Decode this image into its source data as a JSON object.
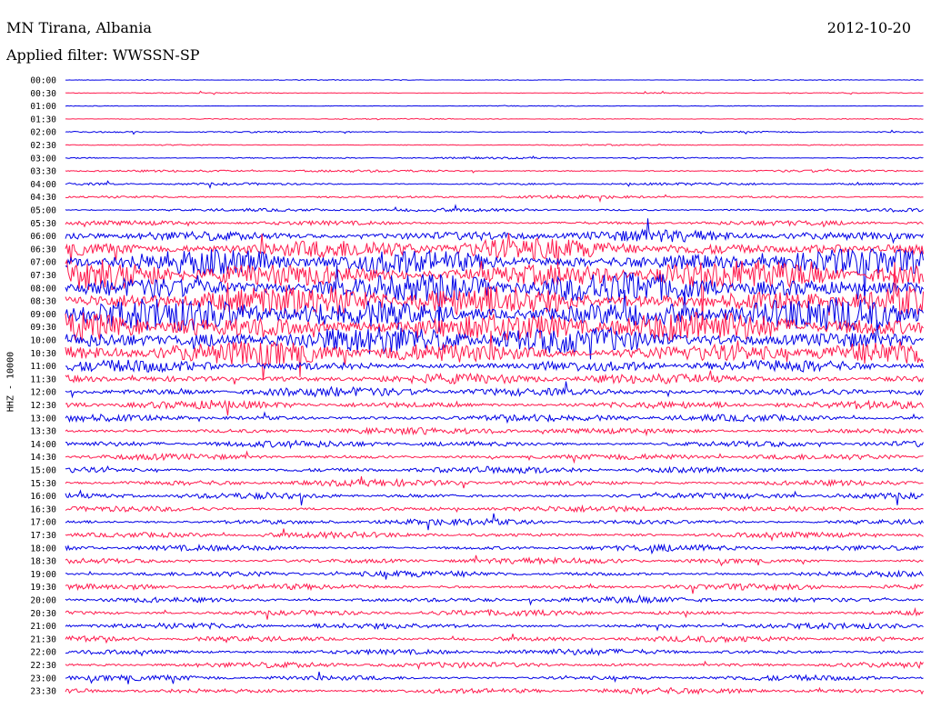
{
  "header": {
    "station": "MN Tirana, Albania",
    "filter": "Applied filter: WWSSN-SP",
    "date": "2012-10-20"
  },
  "chart_data": {
    "type": "line",
    "title": "MN Tirana, Albania",
    "subtitle": "Applied filter: WWSSN-SP",
    "date": "2012-10-20",
    "ylabel": "HHZ - 10000",
    "xlabel": "",
    "tick_labels": [
      "00:00",
      "00:30",
      "01:00",
      "01:30",
      "02:00",
      "02:30",
      "03:00",
      "03:30",
      "04:00",
      "04:30",
      "05:00",
      "05:30",
      "06:00",
      "06:30",
      "07:00",
      "07:30",
      "08:00",
      "08:30",
      "09:00",
      "09:30",
      "10:00",
      "10:30",
      "11:00",
      "11:30",
      "12:00",
      "12:30",
      "13:00",
      "13:30",
      "14:00",
      "14:30",
      "15:00",
      "15:30",
      "16:00",
      "16:30",
      "17:00",
      "17:30",
      "18:00",
      "18:30",
      "19:00",
      "19:30",
      "20:00",
      "20:30",
      "21:00",
      "21:30",
      "22:00",
      "22:30",
      "23:00",
      "23:30"
    ],
    "trace_colors": [
      "#0000e6",
      "#ff1a4d"
    ],
    "grid": false,
    "rows": [
      {
        "start": "00:00",
        "activity": 0.06
      },
      {
        "start": "00:30",
        "activity": 0.08
      },
      {
        "start": "01:00",
        "activity": 0.06
      },
      {
        "start": "01:30",
        "activity": 0.08
      },
      {
        "start": "02:00",
        "activity": 0.12
      },
      {
        "start": "02:30",
        "activity": 0.1
      },
      {
        "start": "03:00",
        "activity": 0.14
      },
      {
        "start": "03:30",
        "activity": 0.18
      },
      {
        "start": "04:00",
        "activity": 0.2
      },
      {
        "start": "04:30",
        "activity": 0.22
      },
      {
        "start": "05:00",
        "activity": 0.25
      },
      {
        "start": "05:30",
        "activity": 0.35
      },
      {
        "start": "06:00",
        "activity": 0.9
      },
      {
        "start": "06:30",
        "activity": 1.6
      },
      {
        "start": "07:00",
        "activity": 2.0
      },
      {
        "start": "07:30",
        "activity": 2.2
      },
      {
        "start": "08:00",
        "activity": 2.4
      },
      {
        "start": "08:30",
        "activity": 2.5
      },
      {
        "start": "09:00",
        "activity": 2.5
      },
      {
        "start": "09:30",
        "activity": 2.4
      },
      {
        "start": "10:00",
        "activity": 2.2
      },
      {
        "start": "10:30",
        "activity": 1.8
      },
      {
        "start": "11:00",
        "activity": 0.9
      },
      {
        "start": "11:30",
        "activity": 0.8
      },
      {
        "start": "12:00",
        "activity": 0.7
      },
      {
        "start": "12:30",
        "activity": 0.6
      },
      {
        "start": "13:00",
        "activity": 0.55
      },
      {
        "start": "13:30",
        "activity": 0.5
      },
      {
        "start": "14:00",
        "activity": 0.5
      },
      {
        "start": "14:30",
        "activity": 0.45
      },
      {
        "start": "15:00",
        "activity": 0.5
      },
      {
        "start": "15:30",
        "activity": 0.5
      },
      {
        "start": "16:00",
        "activity": 0.45
      },
      {
        "start": "16:30",
        "activity": 0.45
      },
      {
        "start": "17:00",
        "activity": 0.45
      },
      {
        "start": "17:30",
        "activity": 0.45
      },
      {
        "start": "18:00",
        "activity": 0.45
      },
      {
        "start": "18:30",
        "activity": 0.45
      },
      {
        "start": "19:00",
        "activity": 0.45
      },
      {
        "start": "19:30",
        "activity": 0.45
      },
      {
        "start": "20:00",
        "activity": 0.45
      },
      {
        "start": "20:30",
        "activity": 0.45
      },
      {
        "start": "21:00",
        "activity": 0.45
      },
      {
        "start": "21:30",
        "activity": 0.45
      },
      {
        "start": "22:00",
        "activity": 0.45
      },
      {
        "start": "22:30",
        "activity": 0.45
      },
      {
        "start": "23:00",
        "activity": 0.4
      },
      {
        "start": "23:30",
        "activity": 0.45
      }
    ]
  }
}
